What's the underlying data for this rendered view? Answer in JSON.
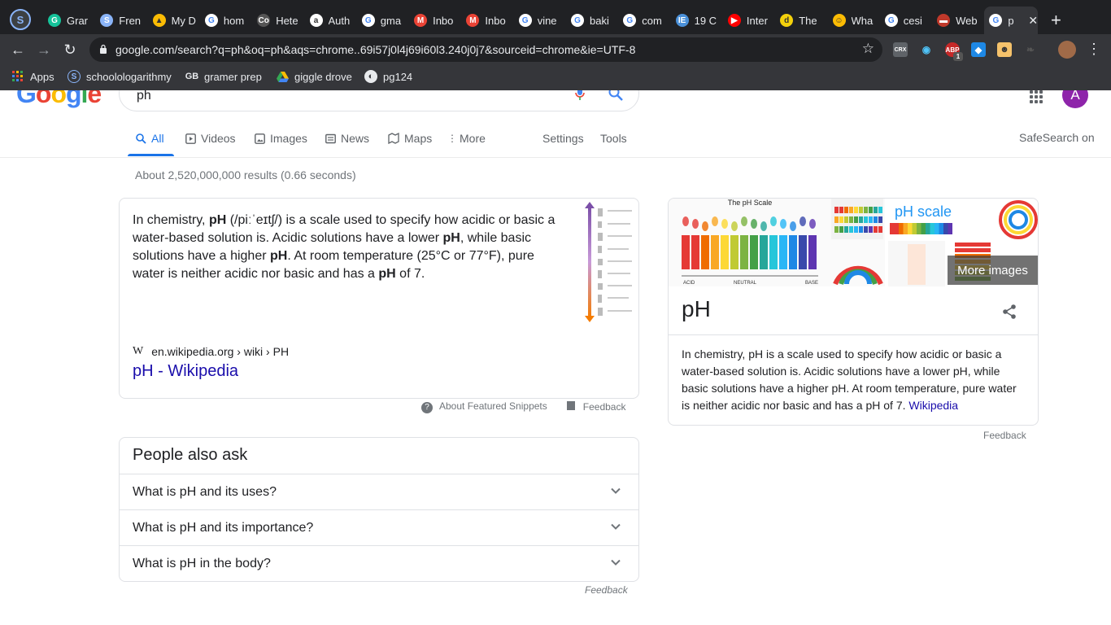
{
  "browser": {
    "tabs": [
      {
        "title": "Grar",
        "icon": "grammarly-icon",
        "color": "#15c39a",
        "glyph": "G"
      },
      {
        "title": "Fren",
        "icon": "schoology-icon",
        "color": "#8ab4f8",
        "glyph": "S"
      },
      {
        "title": "My D",
        "icon": "google-drive-icon",
        "color": "#fbbc04",
        "glyph": "▲"
      },
      {
        "title": "hom",
        "icon": "google-icon",
        "color": "#ffffff",
        "glyph": "G"
      },
      {
        "title": "Hete",
        "icon": "course-hero-icon",
        "color": "#555555",
        "glyph": "Co"
      },
      {
        "title": "Auth",
        "icon": "amazon-icon",
        "color": "#ffffff",
        "glyph": "a"
      },
      {
        "title": "gma",
        "icon": "google-icon",
        "color": "#ffffff",
        "glyph": "G"
      },
      {
        "title": "Inbo",
        "icon": "gmail-icon",
        "color": "#ea4335",
        "glyph": "M"
      },
      {
        "title": "Inbo",
        "icon": "gmail-icon",
        "color": "#ea4335",
        "glyph": "M"
      },
      {
        "title": "vine",
        "icon": "google-icon",
        "color": "#ffffff",
        "glyph": "G"
      },
      {
        "title": "baki",
        "icon": "google-icon",
        "color": "#ffffff",
        "glyph": "G"
      },
      {
        "title": "com",
        "icon": "google-icon",
        "color": "#ffffff",
        "glyph": "G"
      },
      {
        "title": "19 C",
        "icon": "ixl-icon",
        "color": "#4a90d9",
        "glyph": "IE"
      },
      {
        "title": "Inter",
        "icon": "youtube-icon",
        "color": "#ff0000",
        "glyph": "▶"
      },
      {
        "title": "The",
        "icon": "dictionary-icon",
        "color": "#f4d10b",
        "glyph": "d"
      },
      {
        "title": "Wha",
        "icon": "emoji-icon",
        "color": "#fbbc04",
        "glyph": "☺"
      },
      {
        "title": "cesi",
        "icon": "google-icon",
        "color": "#ffffff",
        "glyph": "G"
      },
      {
        "title": "Web",
        "icon": "flag-icon",
        "color": "#c0392b",
        "glyph": "▬"
      },
      {
        "title": "p",
        "icon": "google-icon",
        "color": "#ffffff",
        "glyph": "G"
      }
    ],
    "new_tab": "+",
    "close_tab": "✕",
    "url": "google.com/search?q=ph&oq=ph&aqs=chrome..69i57j0l4j69i60l3.240j0j7&sourceid=chrome&ie=UTF-8",
    "bookmarks": [
      {
        "label": "Apps",
        "icon": "apps-grid-icon"
      },
      {
        "label": "schoolologarithmy",
        "icon": "schoology-icon"
      },
      {
        "label": "gramer prep",
        "icon": "gb-icon"
      },
      {
        "label": "giggle drove",
        "icon": "google-drive-icon"
      },
      {
        "label": "pg124",
        "icon": "globe-icon"
      }
    ],
    "extension_badge": "1"
  },
  "google": {
    "query": "ph",
    "avatar_letter": "A",
    "nav_tabs": [
      {
        "label": "All",
        "icon": "search-icon",
        "glyph": "🔍︎"
      },
      {
        "label": "Videos",
        "icon": "video-icon",
        "glyph": "▷"
      },
      {
        "label": "Images",
        "icon": "image-icon",
        "glyph": "▣"
      },
      {
        "label": "News",
        "icon": "news-icon",
        "glyph": "▤"
      },
      {
        "label": "Maps",
        "icon": "map-icon",
        "glyph": "⌖"
      },
      {
        "label": "More",
        "icon": "more-vert-icon",
        "glyph": "⋮"
      },
      {
        "label": "Settings",
        "icon": "",
        "glyph": ""
      },
      {
        "label": "Tools",
        "icon": "",
        "glyph": ""
      }
    ],
    "safesearch": "SafeSearch on",
    "result_stats": "About 2,520,000,000 results (0.66 seconds)",
    "snippet": {
      "text_html": "In chemistry, <b>pH</b> (/piːˈeɪtʃ/) is a scale used to specify how acidic or basic a water-based solution is. Acidic solutions have a lower <b>pH</b>, while basic solutions have a higher <b>pH</b>. At room temperature (25°C or 77°F), pure water is neither acidic nor basic and has a <b>pH</b> of 7.",
      "source_icon": "W",
      "source": "en.wikipedia.org › wiki › PH",
      "link": "pH - Wikipedia",
      "about": "About Featured Snippets",
      "feedback": "Feedback"
    },
    "people_also_ask": {
      "heading": "People also ask",
      "questions": [
        "What is pH and its uses?",
        "What is pH and its importance?",
        "What is pH in the body?"
      ],
      "feedback": "Feedback"
    },
    "knowledge_panel": {
      "image_caption": "The pH Scale",
      "scale_labels": [
        "ACID",
        "NEUTRAL",
        "BASE"
      ],
      "second_image_title": "pH scale",
      "more_images": "More images",
      "title": "pH",
      "description": "In chemistry, pH is a scale used to specify how acidic or basic a water-based solution is. Acidic solutions have a lower pH, while basic solutions have a higher pH. At room temperature, pure water is neither acidic nor basic and has a pH of 7.",
      "source_link": "Wikipedia",
      "feedback": "Feedback"
    },
    "colors": {
      "link": "#1a0dab",
      "active_tab": "#1a73e8",
      "ph_scale": [
        "#e53935",
        "#e53935",
        "#ef6c00",
        "#f9a825",
        "#fdd835",
        "#c0ca33",
        "#7cb342",
        "#43a047",
        "#26a69a",
        "#26c6da",
        "#29b6f6",
        "#1e88e5",
        "#3949ab",
        "#5e35b1"
      ]
    }
  }
}
